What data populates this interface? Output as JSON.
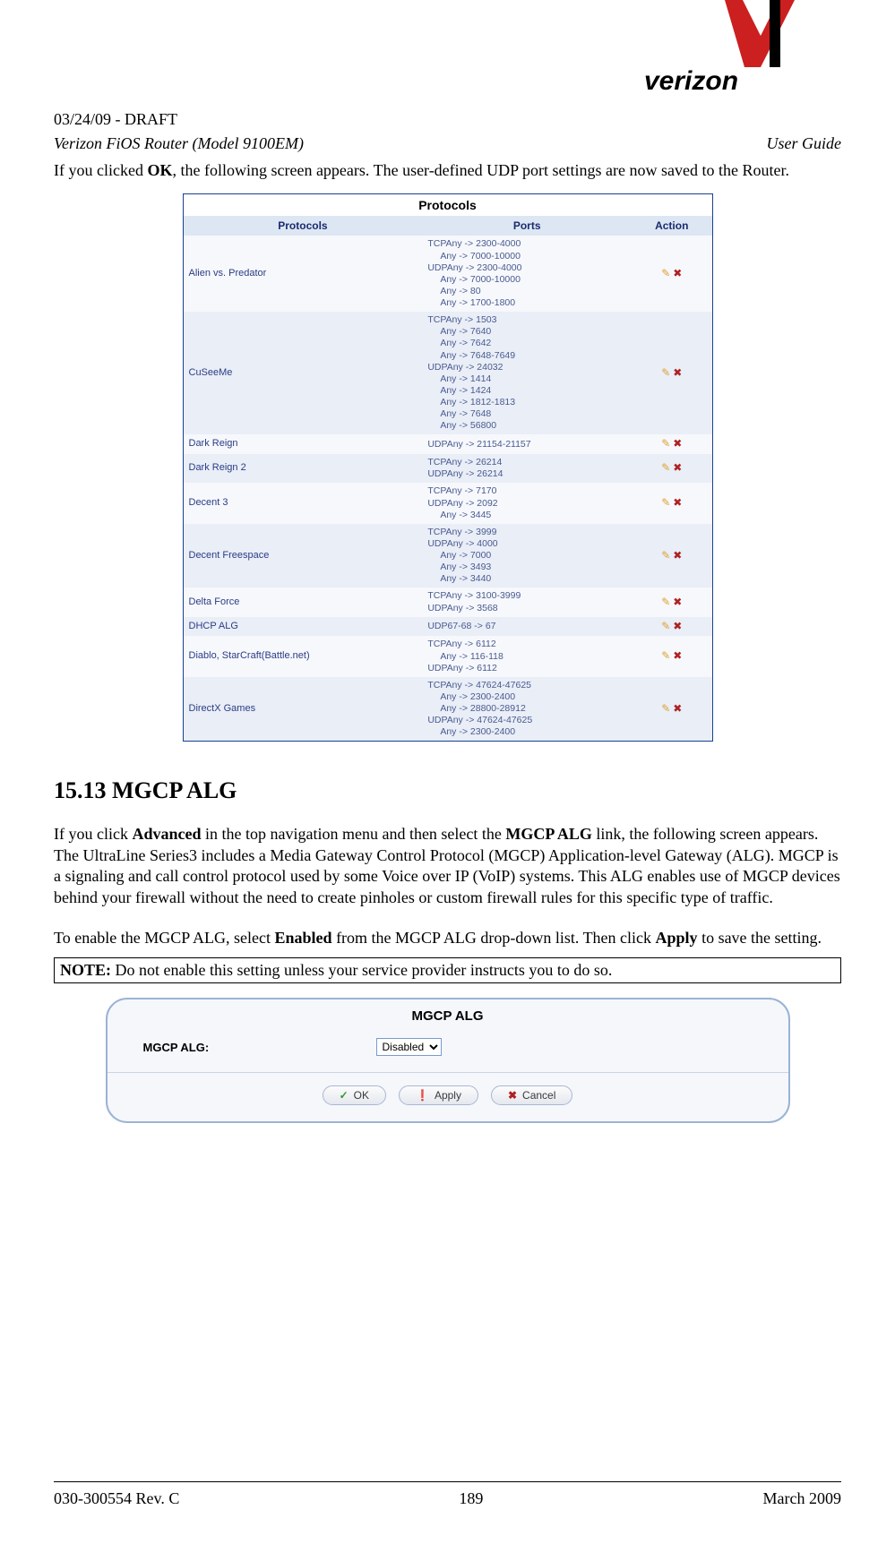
{
  "header": {
    "draft_line": "03/24/09 - DRAFT",
    "left": "Verizon FiOS Router (Model 9100EM)",
    "right": "User Guide"
  },
  "intro": {
    "prefix": "If you clicked ",
    "bold": "OK",
    "suffix": ", the following screen appears. The user-defined UDP port settings are now saved to the Router."
  },
  "protocols": {
    "title": "Protocols",
    "headers": {
      "col1": "Protocols",
      "col2": "Ports",
      "col3": "Action"
    },
    "rows": [
      {
        "name": "Alien vs. Predator",
        "ports": "TCPAny -> 2300-4000\n     Any -> 7000-10000\nUDPAny -> 2300-4000\n     Any -> 7000-10000\n     Any -> 80\n     Any -> 1700-1800"
      },
      {
        "name": "CuSeeMe",
        "ports": "TCPAny -> 1503\n     Any -> 7640\n     Any -> 7642\n     Any -> 7648-7649\nUDPAny -> 24032\n     Any -> 1414\n     Any -> 1424\n     Any -> 1812-1813\n     Any -> 7648\n     Any -> 56800"
      },
      {
        "name": "Dark Reign",
        "ports": "UDPAny -> 21154-21157"
      },
      {
        "name": "Dark Reign 2",
        "ports": "TCPAny -> 26214\nUDPAny -> 26214"
      },
      {
        "name": "Decent 3",
        "ports": "TCPAny -> 7170\nUDPAny -> 2092\n     Any -> 3445"
      },
      {
        "name": "Decent Freespace",
        "ports": "TCPAny -> 3999\nUDPAny -> 4000\n     Any -> 7000\n     Any -> 3493\n     Any -> 3440"
      },
      {
        "name": "Delta Force",
        "ports": "TCPAny -> 3100-3999\nUDPAny -> 3568"
      },
      {
        "name": "DHCP ALG",
        "ports": "UDP67-68 -> 67"
      },
      {
        "name": "Diablo, StarCraft(Battle.net)",
        "ports": "TCPAny -> 6112\n     Any -> 116-118\nUDPAny -> 6112"
      },
      {
        "name": "DirectX Games",
        "ports": "TCPAny -> 47624-47625\n     Any -> 2300-2400\n     Any -> 28800-28912\nUDPAny -> 47624-47625\n     Any -> 2300-2400"
      }
    ]
  },
  "section": {
    "number": "15.13",
    "spacer": "   ",
    "title": "MGCP ALG"
  },
  "para1": {
    "p1": "If you click ",
    "b1": "Advanced",
    "p2": " in the top navigation menu and then select the ",
    "b2": "MGCP ALG",
    "p3": " link, the following screen appears. The UltraLine Series3 includes a Media Gateway Control Protocol (MGCP) Application-level Gateway (ALG).  MGCP is a signaling and call control protocol used by some Voice over IP (VoIP) systems. This ALG enables use of MGCP devices behind your firewall without the need to create pinholes or custom firewall rules for this specific type of traffic."
  },
  "para2": {
    "p1": "To enable the MGCP ALG, select ",
    "b1": "Enabled",
    "p2": " from the MGCP ALG drop-down list. Then click ",
    "b2": "Apply",
    "p3": " to save the setting."
  },
  "note": {
    "label": "NOTE:",
    "text": " Do not enable this setting unless your service provider instructs you to do so."
  },
  "mgcp_panel": {
    "title": "MGCP ALG",
    "label": "MGCP ALG:",
    "select_value": "Disabled",
    "buttons": {
      "ok": "OK",
      "apply": "Apply",
      "cancel": "Cancel"
    }
  },
  "footer": {
    "left": "030-300554 Rev. C",
    "center": "189",
    "right": "March 2009"
  }
}
